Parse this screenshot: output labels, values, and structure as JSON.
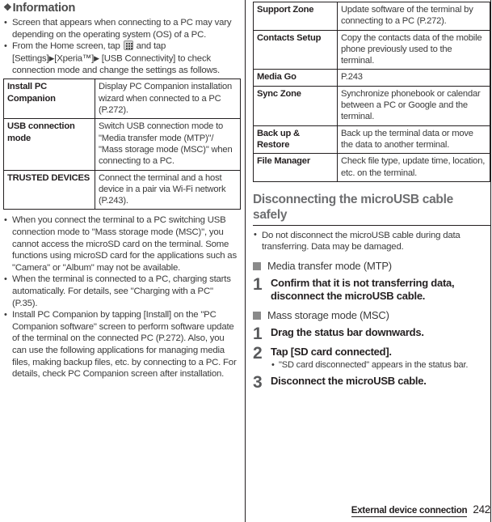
{
  "left_column": {
    "info_heading": {
      "bullet_glyph": "❖",
      "text": "Information"
    },
    "info_bullets": [
      "Screen that appears when connecting to a PC may vary depending on the operating system (OS) of a PC.",
      "From the Home screen, tap [app-drawer-icon] and tap [Settings]▶[Xperia™]▶ [USB Connectivity] to check connection mode and change the settings as follows."
    ],
    "info_bullet_2_parts": {
      "before_icon": "From the Home screen, tap ",
      "after_icon": " and tap [Settings]",
      "tri1": "▶",
      "mid": "[Xperia™]",
      "tri2": "▶",
      "tail": " [USB Connectivity] to check connection mode and change the settings as follows."
    },
    "table": {
      "rows": [
        {
          "key": "Install PC Companion",
          "value": "Display PC Companion installation wizard when connected to a PC (P.272)."
        },
        {
          "key": "USB connection mode",
          "value": "Switch USB connection mode to \"Media transfer mode (MTP)\"/ \"Mass storage mode (MSC)\" when connecting to a PC."
        },
        {
          "key": "TRUSTED DEVICES",
          "value": "Connect the terminal and a host device in a pair via Wi-Fi network (P.243)."
        }
      ]
    },
    "after_table_bullets": [
      "When you connect the terminal to a PC switching USB connection mode to \"Mass storage mode (MSC)\", you cannot access the microSD card on the terminal. Some functions using microSD card for the applications such as \"Camera\" or \"Album\" may not be available.",
      "When the terminal is connected to a PC, charging starts automatically. For details, see \"Charging with a PC\" (P.35).",
      "Install PC Companion by tapping [Install] on the \"PC Companion software\" screen to perform software update of the terminal on the connected PC (P.272). Also, you can use the following applications for managing media files, making backup files, etc. by connecting to a PC. For details, check PC Companion screen after installation."
    ]
  },
  "right_column": {
    "table": {
      "rows": [
        {
          "key": "Support Zone",
          "value": "Update software of the terminal by connecting to a PC (P.272)."
        },
        {
          "key": "Contacts Setup",
          "value": "Copy the contacts data of the mobile phone previously used to the terminal."
        },
        {
          "key": "Media Go",
          "value": "P.243"
        },
        {
          "key": "Sync Zone",
          "value": "Synchronize phonebook or calendar between a PC or Google and the terminal."
        },
        {
          "key": "Back up & Restore",
          "value": "Back up the terminal data or move the data to another terminal."
        },
        {
          "key": "File Manager",
          "value": "Check file type, update time, location, etc. on the terminal."
        }
      ]
    },
    "section_heading": "Disconnecting the microUSB cable safely",
    "section_bullets": [
      "Do not disconnect the microUSB cable during data transferring. Data may be damaged."
    ],
    "subsections": [
      {
        "marker": "■",
        "title": "Media transfer mode (MTP)",
        "steps": [
          {
            "number": "1",
            "title": "Confirm that it is not transferring data, disconnect the microUSB cable.",
            "notes": []
          }
        ]
      },
      {
        "marker": "■",
        "title": "Mass storage mode (MSC)",
        "steps": [
          {
            "number": "1",
            "title": "Drag the status bar downwards.",
            "notes": []
          },
          {
            "number": "2",
            "title": "Tap [SD card connected].",
            "notes": [
              "\"SD card disconnected\" appears in the status bar."
            ]
          },
          {
            "number": "3",
            "title": "Disconnect the microUSB cable.",
            "notes": []
          }
        ]
      }
    ]
  },
  "footer": {
    "section_name": "External device connection",
    "page_number": "242"
  },
  "colors": {
    "text": "#231f20",
    "body_text": "#3a3a3a",
    "heading_gray": "#6d6e70",
    "info_head_gray": "#4a4a4a",
    "marker_gray": "#8a8a8a",
    "step_number": "#58595b",
    "rule": "#231f20"
  }
}
